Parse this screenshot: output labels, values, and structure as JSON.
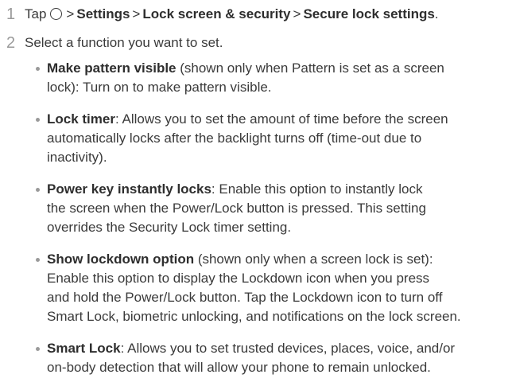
{
  "step1": {
    "number": "1",
    "prefix": "Tap",
    "home_icon": "circle-home-icon",
    "sep": ">",
    "path": [
      "Settings",
      "Lock screen & security",
      "Secure lock settings"
    ],
    "period": "."
  },
  "step2": {
    "number": "2",
    "text": "Select a function you want to set."
  },
  "items": [
    {
      "term": "Make pattern visible",
      "lines": [
        " (shown only when Pattern is set as a screen",
        "lock): Turn on to make pattern visible."
      ]
    },
    {
      "term": "Lock timer",
      "lines": [
        ": Allows you to set the amount of time before the screen",
        "automatically locks after the backlight turns off (time-out due to",
        "inactivity)."
      ]
    },
    {
      "term": "Power key instantly locks",
      "lines": [
        ": Enable this option to instantly lock",
        "the screen when the Power/Lock button is pressed. This setting",
        "overrides the Security Lock timer setting."
      ]
    },
    {
      "term": "Show lockdown option",
      "lines": [
        " (shown only when a screen lock is set):",
        "Enable this option to display the Lockdown icon when you press",
        "and hold the Power/Lock button. Tap the Lockdown icon to turn off",
        "Smart Lock, biometric unlocking, and notifications on the lock screen."
      ]
    },
    {
      "term": "Smart Lock",
      "lines": [
        ": Allows you to set trusted devices, places, voice, and/or",
        "on-body detection that will allow your phone to remain unlocked."
      ]
    }
  ]
}
